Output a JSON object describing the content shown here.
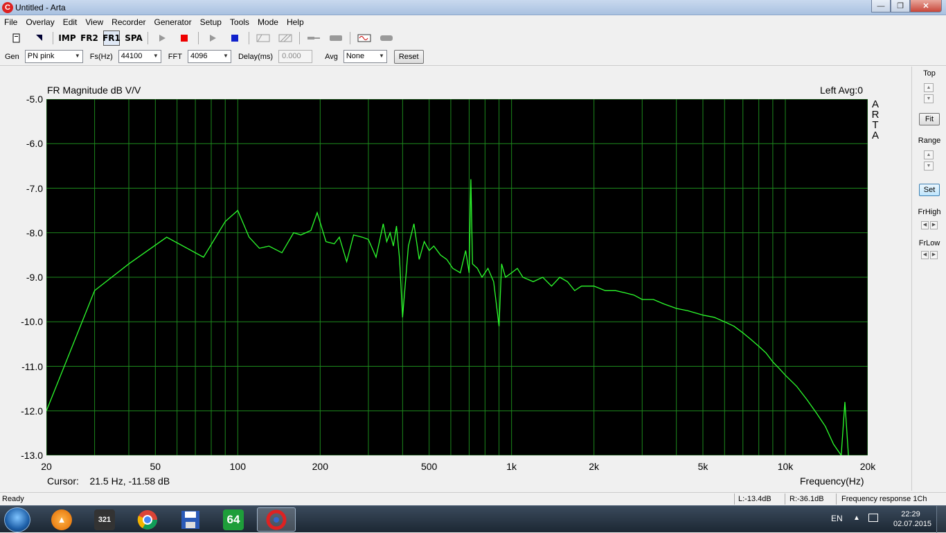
{
  "window": {
    "title": "Untitled - Arta",
    "app_icon": "C"
  },
  "menu": [
    "File",
    "Overlay",
    "Edit",
    "View",
    "Recorder",
    "Generator",
    "Setup",
    "Tools",
    "Mode",
    "Help"
  ],
  "toolbar": {
    "imp": "IMP",
    "fr2": "FR2",
    "fr1": "FR1",
    "spa": "SPA"
  },
  "controls": {
    "gen_label": "Gen",
    "gen_value": "PN pink",
    "fs_label": "Fs(Hz)",
    "fs_value": "44100",
    "fft_label": "FFT",
    "fft_value": "4096",
    "delay_label": "Delay(ms)",
    "delay_value": "0.000",
    "avg_label": "Avg",
    "avg_value": "None",
    "reset_label": "Reset"
  },
  "plot": {
    "title": "FR Magnitude dB V/V",
    "top_right": "Left  Avg:0",
    "arta_mark": [
      "A",
      "R",
      "T",
      "A"
    ],
    "cursor_label": "Cursor:",
    "cursor_value": "21.5 Hz, -11.58 dB",
    "xlabel": "Frequency(Hz)"
  },
  "chart_data": {
    "type": "line",
    "title": "FR Magnitude dB V/V",
    "xlabel": "Frequency(Hz)",
    "ylabel": "",
    "x_scale": "log",
    "xlim": [
      20,
      20000
    ],
    "ylim": [
      -13.0,
      -5.0
    ],
    "x_ticks": [
      "20",
      "50",
      "100",
      "200",
      "500",
      "1k",
      "2k",
      "5k",
      "10k",
      "20k"
    ],
    "y_ticks": [
      "-5.0",
      "-6.0",
      "-7.0",
      "-8.0",
      "-9.0",
      "-10.0",
      "-11.0",
      "-12.0",
      "-13.0"
    ],
    "grid": true,
    "series": [
      {
        "color": "#2dff2d",
        "x": [
          20,
          30,
          40,
          55,
          75,
          90,
          100,
          110,
          120,
          130,
          145,
          160,
          170,
          185,
          195,
          210,
          225,
          235,
          250,
          265,
          285,
          300,
          320,
          340,
          350,
          360,
          370,
          380,
          390,
          400,
          420,
          440,
          460,
          480,
          500,
          520,
          550,
          580,
          610,
          650,
          680,
          700,
          710,
          720,
          750,
          780,
          820,
          860,
          900,
          920,
          950,
          1000,
          1050,
          1100,
          1200,
          1300,
          1400,
          1500,
          1600,
          1700,
          1800,
          2000,
          2200,
          2400,
          2600,
          2800,
          3000,
          3300,
          3600,
          4000,
          4400,
          5000,
          5500,
          6000,
          6500,
          7000,
          7500,
          8000,
          8500,
          9000,
          9500,
          10000,
          11000,
          12000,
          13000,
          14000,
          15000,
          16000,
          16500,
          17000
        ],
        "y": [
          -12.0,
          -9.3,
          -8.7,
          -8.1,
          -8.55,
          -7.75,
          -7.5,
          -8.1,
          -8.35,
          -8.3,
          -8.45,
          -8.0,
          -8.05,
          -7.95,
          -7.55,
          -8.2,
          -8.25,
          -8.1,
          -8.65,
          -8.05,
          -8.1,
          -8.15,
          -8.55,
          -7.8,
          -8.2,
          -8.0,
          -8.3,
          -7.85,
          -8.6,
          -9.9,
          -8.3,
          -7.8,
          -8.6,
          -8.2,
          -8.4,
          -8.3,
          -8.5,
          -8.6,
          -8.8,
          -8.9,
          -8.4,
          -8.9,
          -6.8,
          -8.7,
          -8.8,
          -9.0,
          -8.8,
          -9.1,
          -10.1,
          -8.7,
          -9.0,
          -8.9,
          -8.8,
          -9.0,
          -9.1,
          -9.0,
          -9.2,
          -9.0,
          -9.1,
          -9.3,
          -9.2,
          -9.2,
          -9.3,
          -9.3,
          -9.35,
          -9.4,
          -9.5,
          -9.5,
          -9.6,
          -9.7,
          -9.75,
          -9.85,
          -9.9,
          -10.0,
          -10.1,
          -10.25,
          -10.4,
          -10.55,
          -10.7,
          -10.9,
          -11.05,
          -11.2,
          -11.45,
          -11.75,
          -12.05,
          -12.35,
          -12.75,
          -13.0,
          -11.8,
          -13.0
        ]
      }
    ]
  },
  "right_panel": {
    "top_label": "Top",
    "fit_label": "Fit",
    "range_label": "Range",
    "set_label": "Set",
    "frhigh_label": "FrHigh",
    "frlow_label": "FrLow"
  },
  "status": {
    "ready": "Ready",
    "left_level": "L:-13.4dB",
    "right_level": "R:-36.1dB",
    "mode": "Frequency response 1Ch"
  },
  "taskbar": {
    "lang": "EN",
    "time": "22:29",
    "date": "02.07.2015",
    "apps": [
      "start-orb",
      "aimp",
      "media-player-classic",
      "chrome",
      "save",
      "64",
      "arta"
    ]
  }
}
